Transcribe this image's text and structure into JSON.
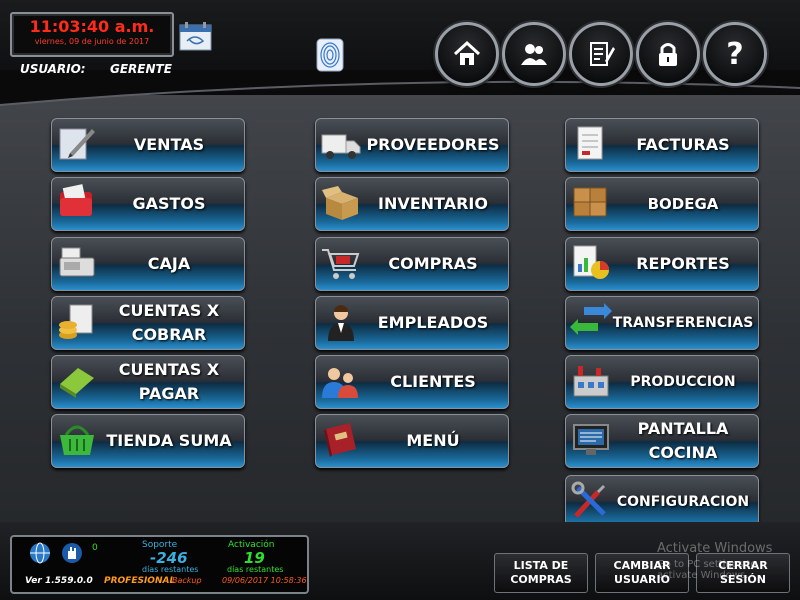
{
  "header": {
    "time": "11:03:40 a.m.",
    "date": "viernes, 09 de junio de 2017",
    "user_label": "USUARIO:",
    "user_value": "GERENTE"
  },
  "nav_buttons": [
    {
      "name": "home-button",
      "icon": "home-icon"
    },
    {
      "name": "users-button",
      "icon": "users-icon"
    },
    {
      "name": "notes-button",
      "icon": "edit-icon"
    },
    {
      "name": "lock-button",
      "icon": "lock-icon"
    },
    {
      "name": "help-button",
      "icon": "help-icon",
      "label": "?"
    }
  ],
  "menu": {
    "ventas": "VENTAS",
    "gastos": "GASTOS",
    "caja": "CAJA",
    "cuentas_cobrar_1": "CUENTAS X",
    "cuentas_cobrar_2": "COBRAR",
    "cuentas_pagar_1": "CUENTAS X",
    "cuentas_pagar_2": "PAGAR",
    "tienda_suma": "TIENDA SUMA",
    "proveedores": "PROVEEDORES",
    "inventario": "INVENTARIO",
    "compras": "COMPRAS",
    "empleados": "EMPLEADOS",
    "clientes": "CLIENTES",
    "menu": "MENÚ",
    "facturas": "FACTURAS",
    "bodega": "BODEGA",
    "reportes": "REPORTES",
    "transferencias": "TRANSFERENCIAS",
    "produccion": "PRODUCCION",
    "pantalla_1": "PANTALLA",
    "pantalla_2": "COCINA",
    "configuracion": "CONFIGURACION"
  },
  "status": {
    "counter": "0",
    "soporte_label": "Soporte",
    "soporte_value": "-246",
    "soporte_sub": "días restantes",
    "activacion_label": "Activación",
    "activacion_value": "19",
    "activacion_sub": "días restantes",
    "version": "Ver 1.559.0.0",
    "edition": "PROFESIONAL",
    "backup_label": "Backup",
    "backup_date": "09/06/2017 10:58:36"
  },
  "bottom_buttons": {
    "lista_1": "LISTA DE",
    "lista_2": "COMPRAS",
    "cambiar_1": "CAMBIAR",
    "cambiar_2": "USUARIO",
    "cerrar_1": "CERRAR",
    "cerrar_2": "SESIÓN"
  },
  "watermark": {
    "line1": "Activate Windows",
    "line2": "Go to PC settings to activate Windows."
  },
  "colors": {
    "clock_red": "#ff2a1a",
    "accent_blue": "#2a8fcf",
    "status_green": "#2ee02e"
  }
}
